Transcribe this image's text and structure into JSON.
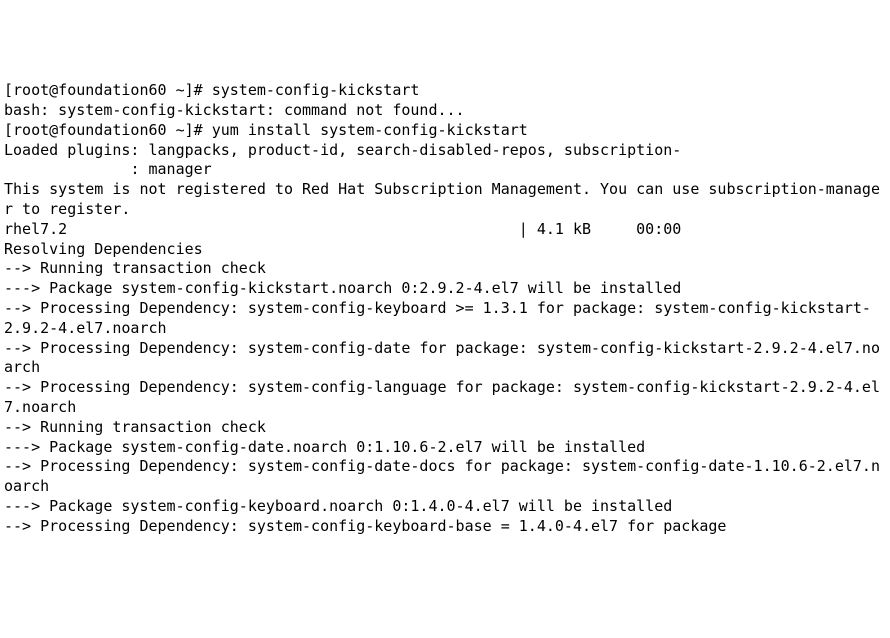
{
  "terminal": {
    "lines": [
      "[root@foundation60 ~]# system-config-kickstart",
      "bash: system-config-kickstart: command not found...",
      "[root@foundation60 ~]# yum install system-config-kickstart",
      "Loaded plugins: langpacks, product-id, search-disabled-repos, subscription-",
      "              : manager",
      "This system is not registered to Red Hat Subscription Management. You can use subscription-manager to register.",
      "rhel7.2                                                  | 4.1 kB     00:00",
      "Resolving Dependencies",
      "--> Running transaction check",
      "---> Package system-config-kickstart.noarch 0:2.9.2-4.el7 will be installed",
      "--> Processing Dependency: system-config-keyboard >= 1.3.1 for package: system-config-kickstart-2.9.2-4.el7.noarch",
      "--> Processing Dependency: system-config-date for package: system-config-kickstart-2.9.2-4.el7.noarch",
      "--> Processing Dependency: system-config-language for package: system-config-kickstart-2.9.2-4.el7.noarch",
      "--> Running transaction check",
      "---> Package system-config-date.noarch 0:1.10.6-2.el7 will be installed",
      "--> Processing Dependency: system-config-date-docs for package: system-config-date-1.10.6-2.el7.noarch",
      "---> Package system-config-keyboard.noarch 0:1.4.0-4.el7 will be installed",
      "--> Processing Dependency: system-config-keyboard-base = 1.4.0-4.el7 for package"
    ]
  }
}
